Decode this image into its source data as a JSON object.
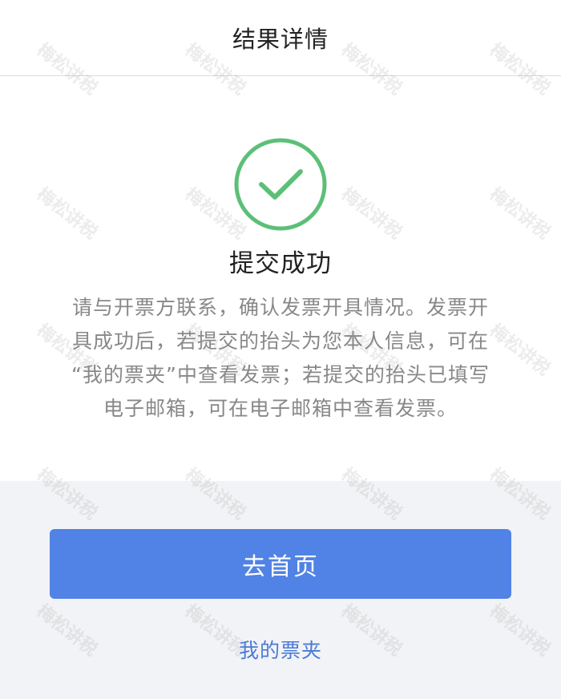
{
  "header": {
    "title": "结果详情"
  },
  "result": {
    "icon": "check-circle-icon",
    "status_color": "#5cbf78",
    "title": "提交成功",
    "description_lines": [
      "请与开票方联系，确认发票开具情况。发票开",
      "具成功后，若提交的抬头为您本人信息，可在",
      "“我的票夹”中查看发票；若提交的抬头已填写",
      "电子邮箱，可在电子邮箱中查看发票。"
    ]
  },
  "actions": {
    "home_button": "去首页",
    "ticket_folder_link": "我的票夹",
    "accent_color": "#5182e6"
  },
  "watermark": {
    "text": "梅松讲税"
  }
}
